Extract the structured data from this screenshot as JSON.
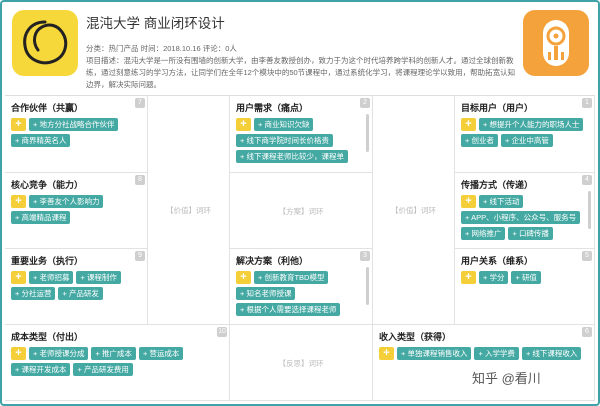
{
  "header": {
    "title": "混沌大学 商业闭环设计",
    "meta": "分类：热门产品   时间：2018.10.16   评论：0人",
    "description": "项目描述：混沌大学是一所没有围墙的创新大学，由李善友教授创办，致力于为这个时代培养跨学科的创新人才。通过全球创新教练，通过刻意练习的学习方法，让同学们在全年12个模块中的50节课程中，通过系统化学习，将课程理论学以致用，帮助拓宽认知边界，解决实际问题。"
  },
  "cells": {
    "partners": {
      "title": "合作伙伴（共赢）",
      "num": "7",
      "chips": [
        "地方分社战略合作伙伴",
        "商界精英名人"
      ]
    },
    "core": {
      "title": "核心竞争（能力）",
      "num": "8",
      "chips": [
        "李善友个人影响力",
        "高端精品课程"
      ]
    },
    "business": {
      "title": "重要业务（执行）",
      "num": "9",
      "chips": [
        "老师招募",
        "课程制作",
        "分社运营",
        "产品研发"
      ]
    },
    "needs": {
      "title": "用户需求（痛点）",
      "num": "2",
      "chips": [
        "商业知识欠缺",
        "线下商学院时间长价格贵",
        "线下课程老师比较少，课程单"
      ]
    },
    "solution": {
      "title": "解决方案（利他）",
      "num": "3",
      "chips": [
        "创新教育TBD模型",
        "知名老师授课",
        "根据个人需要选择课程老师"
      ]
    },
    "target": {
      "title": "目标用户（用户）",
      "num": "1",
      "chips": [
        "想提升个人能力的职场人士",
        "创业者",
        "企业中高管"
      ]
    },
    "channels": {
      "title": "传播方式（传递）",
      "num": "4",
      "chips": [
        "线下活动",
        "APP、小程序、公众号、服务号",
        "网络推广",
        "口碑传播"
      ]
    },
    "relations": {
      "title": "用户关系（维系）",
      "num": "5",
      "chips": [
        "学分",
        "研值"
      ]
    },
    "cost": {
      "title": "成本类型（付出）",
      "num": "10",
      "chips": [
        "老师授课分成",
        "推广成本",
        "营运成本",
        "课程开发成本",
        "产品研发费用"
      ]
    },
    "revenue": {
      "title": "收入类型（获得）",
      "num": "6",
      "chips": [
        "单独课程销售收入",
        "入学学费",
        "线下课程收入"
      ]
    }
  },
  "placeholders": {
    "value1": "【价值】词环",
    "solution": "【方案】词环",
    "value2": "【价值】词环",
    "review": "【反思】词环"
  },
  "watermark": "知乎 @看川",
  "colors": {
    "border": "#3fa2a6",
    "chip": "#45a9a3",
    "add": "#f5cf3a",
    "logo_left": "#f7d83b",
    "logo_right": "#f4a23c"
  }
}
